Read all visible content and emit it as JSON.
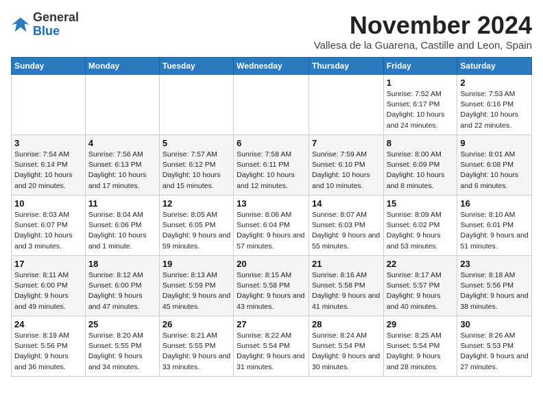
{
  "logo": {
    "general": "General",
    "blue": "Blue"
  },
  "header": {
    "month_title": "November 2024",
    "subtitle": "Vallesa de la Guarena, Castille and Leon, Spain"
  },
  "weekdays": [
    "Sunday",
    "Monday",
    "Tuesday",
    "Wednesday",
    "Thursday",
    "Friday",
    "Saturday"
  ],
  "weeks": [
    [
      {
        "day": "",
        "info": ""
      },
      {
        "day": "",
        "info": ""
      },
      {
        "day": "",
        "info": ""
      },
      {
        "day": "",
        "info": ""
      },
      {
        "day": "",
        "info": ""
      },
      {
        "day": "1",
        "info": "Sunrise: 7:52 AM\nSunset: 6:17 PM\nDaylight: 10 hours\nand 24 minutes."
      },
      {
        "day": "2",
        "info": "Sunrise: 7:53 AM\nSunset: 6:16 PM\nDaylight: 10 hours\nand 22 minutes."
      }
    ],
    [
      {
        "day": "3",
        "info": "Sunrise: 7:54 AM\nSunset: 6:14 PM\nDaylight: 10 hours\nand 20 minutes."
      },
      {
        "day": "4",
        "info": "Sunrise: 7:56 AM\nSunset: 6:13 PM\nDaylight: 10 hours\nand 17 minutes."
      },
      {
        "day": "5",
        "info": "Sunrise: 7:57 AM\nSunset: 6:12 PM\nDaylight: 10 hours\nand 15 minutes."
      },
      {
        "day": "6",
        "info": "Sunrise: 7:58 AM\nSunset: 6:11 PM\nDaylight: 10 hours\nand 12 minutes."
      },
      {
        "day": "7",
        "info": "Sunrise: 7:59 AM\nSunset: 6:10 PM\nDaylight: 10 hours\nand 10 minutes."
      },
      {
        "day": "8",
        "info": "Sunrise: 8:00 AM\nSunset: 6:09 PM\nDaylight: 10 hours\nand 8 minutes."
      },
      {
        "day": "9",
        "info": "Sunrise: 8:01 AM\nSunset: 6:08 PM\nDaylight: 10 hours\nand 6 minutes."
      }
    ],
    [
      {
        "day": "10",
        "info": "Sunrise: 8:03 AM\nSunset: 6:07 PM\nDaylight: 10 hours\nand 3 minutes."
      },
      {
        "day": "11",
        "info": "Sunrise: 8:04 AM\nSunset: 6:06 PM\nDaylight: 10 hours\nand 1 minute."
      },
      {
        "day": "12",
        "info": "Sunrise: 8:05 AM\nSunset: 6:05 PM\nDaylight: 9 hours\nand 59 minutes."
      },
      {
        "day": "13",
        "info": "Sunrise: 8:06 AM\nSunset: 6:04 PM\nDaylight: 9 hours\nand 57 minutes."
      },
      {
        "day": "14",
        "info": "Sunrise: 8:07 AM\nSunset: 6:03 PM\nDaylight: 9 hours\nand 55 minutes."
      },
      {
        "day": "15",
        "info": "Sunrise: 8:09 AM\nSunset: 6:02 PM\nDaylight: 9 hours\nand 53 minutes."
      },
      {
        "day": "16",
        "info": "Sunrise: 8:10 AM\nSunset: 6:01 PM\nDaylight: 9 hours\nand 51 minutes."
      }
    ],
    [
      {
        "day": "17",
        "info": "Sunrise: 8:11 AM\nSunset: 6:00 PM\nDaylight: 9 hours\nand 49 minutes."
      },
      {
        "day": "18",
        "info": "Sunrise: 8:12 AM\nSunset: 6:00 PM\nDaylight: 9 hours\nand 47 minutes."
      },
      {
        "day": "19",
        "info": "Sunrise: 8:13 AM\nSunset: 5:59 PM\nDaylight: 9 hours\nand 45 minutes."
      },
      {
        "day": "20",
        "info": "Sunrise: 8:15 AM\nSunset: 5:58 PM\nDaylight: 9 hours\nand 43 minutes."
      },
      {
        "day": "21",
        "info": "Sunrise: 8:16 AM\nSunset: 5:58 PM\nDaylight: 9 hours\nand 41 minutes."
      },
      {
        "day": "22",
        "info": "Sunrise: 8:17 AM\nSunset: 5:57 PM\nDaylight: 9 hours\nand 40 minutes."
      },
      {
        "day": "23",
        "info": "Sunrise: 8:18 AM\nSunset: 5:56 PM\nDaylight: 9 hours\nand 38 minutes."
      }
    ],
    [
      {
        "day": "24",
        "info": "Sunrise: 8:19 AM\nSunset: 5:56 PM\nDaylight: 9 hours\nand 36 minutes."
      },
      {
        "day": "25",
        "info": "Sunrise: 8:20 AM\nSunset: 5:55 PM\nDaylight: 9 hours\nand 34 minutes."
      },
      {
        "day": "26",
        "info": "Sunrise: 8:21 AM\nSunset: 5:55 PM\nDaylight: 9 hours\nand 33 minutes."
      },
      {
        "day": "27",
        "info": "Sunrise: 8:22 AM\nSunset: 5:54 PM\nDaylight: 9 hours\nand 31 minutes."
      },
      {
        "day": "28",
        "info": "Sunrise: 8:24 AM\nSunset: 5:54 PM\nDaylight: 9 hours\nand 30 minutes."
      },
      {
        "day": "29",
        "info": "Sunrise: 8:25 AM\nSunset: 5:54 PM\nDaylight: 9 hours\nand 28 minutes."
      },
      {
        "day": "30",
        "info": "Sunrise: 8:26 AM\nSunset: 5:53 PM\nDaylight: 9 hours\nand 27 minutes."
      }
    ]
  ]
}
